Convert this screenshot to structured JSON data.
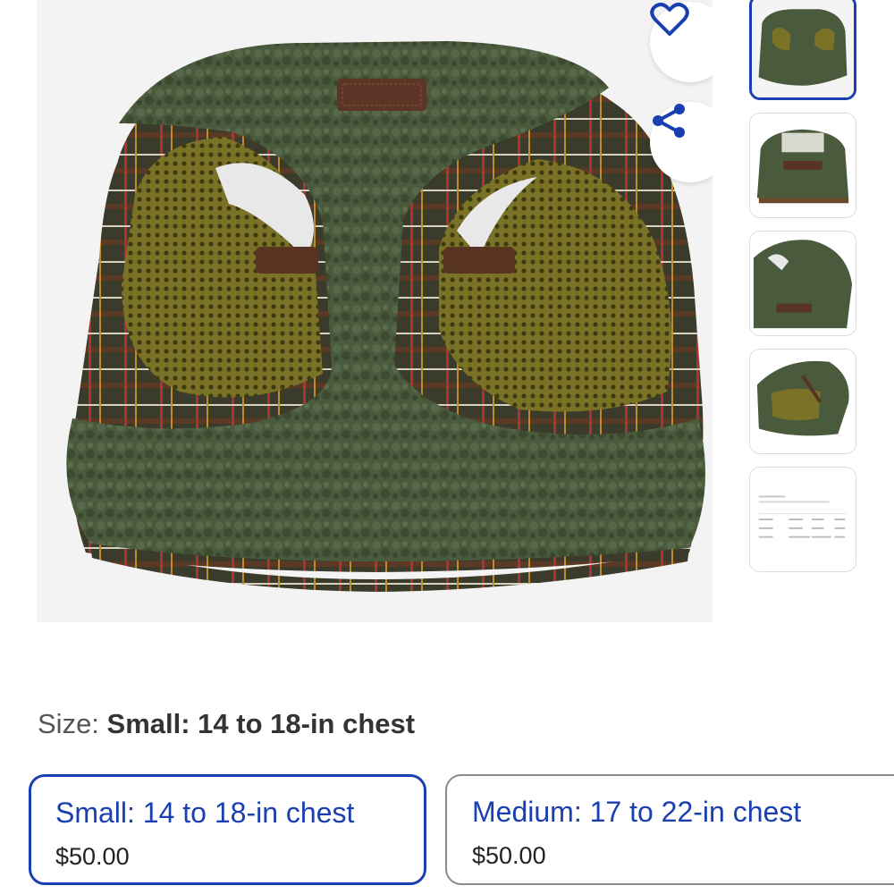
{
  "product": {
    "main_image_alt": "Olive green sherpa dog harness with tartan trim",
    "favorite_icon": "heart-outline-icon",
    "share_icon": "share-icon"
  },
  "thumbnails": [
    {
      "name": "thumb-harness-front",
      "selected": true
    },
    {
      "name": "thumb-harness-back",
      "selected": false
    },
    {
      "name": "thumb-harness-side",
      "selected": false
    },
    {
      "name": "thumb-harness-underside",
      "selected": false
    },
    {
      "name": "thumb-size-chart",
      "selected": false
    }
  ],
  "size": {
    "label": "Size:",
    "selected_value": "Small: 14 to 18-in chest"
  },
  "options": [
    {
      "name": "Small: 14 to 18-in chest",
      "price": "$50.00",
      "selected": true
    },
    {
      "name": "Medium: 17 to 22-in chest",
      "price": "$50.00",
      "selected": false
    }
  ],
  "colors": {
    "accent": "#1a3fb0",
    "harness_green": "#46553a",
    "mesh_olive": "#6e6a24"
  }
}
